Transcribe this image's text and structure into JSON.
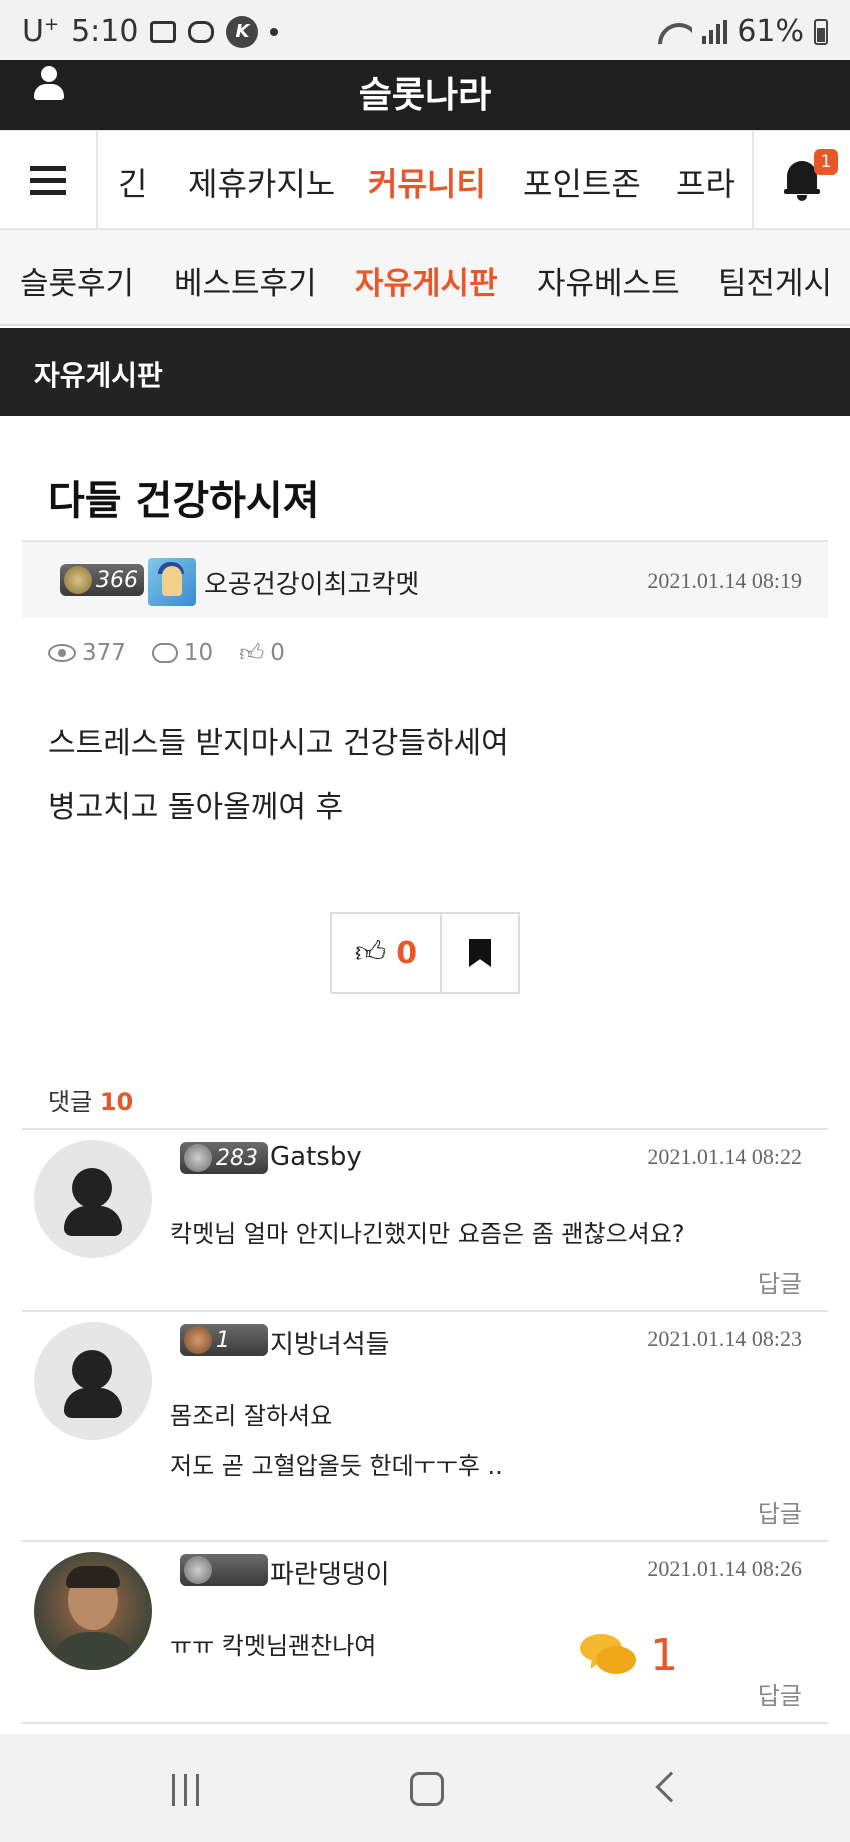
{
  "status_bar": {
    "carrier": "U",
    "carrier_sup": "+",
    "time": "5:10",
    "battery": "61%"
  },
  "header": {
    "site_title": "슬롯나라"
  },
  "main_nav": {
    "items": [
      "긴",
      "제휴카지노",
      "커뮤니티",
      "포인트존",
      "프라"
    ],
    "active": "커뮤니티",
    "notification_count": "1"
  },
  "sub_nav": {
    "items": [
      "슬롯후기",
      "베스트후기",
      "자유게시판",
      "자유베스트",
      "팀전게시"
    ],
    "active": "자유게시판"
  },
  "board": {
    "label": "자유게시판"
  },
  "post": {
    "title": "다들 건강하시져",
    "author": {
      "level": "366",
      "name": "오공건강이최고칵멧"
    },
    "date": "2021.01.14 08:19",
    "views": "377",
    "comments": "10",
    "likes": "0",
    "body": [
      "스트레스들 받지마시고 건강들하세여",
      "병고치고 돌아올께여 후"
    ],
    "like_button_count": "0"
  },
  "comments_section": {
    "label": "댓글",
    "count": "10",
    "items": [
      {
        "level": "283",
        "name": "Gatsby",
        "date": "2021.01.14 08:22",
        "lines": [
          "칵멧님 얼마 안지나긴했지만 요즘은 좀 괜찮으셔요?"
        ],
        "reply": "답글"
      },
      {
        "level": "1",
        "name": "지방녀석들",
        "date": "2021.01.14 08:23",
        "lines": [
          "몸조리 잘하셔요",
          "저도 곧 고혈압올듯 한데ㅜㅜ후 .."
        ],
        "reply": "답글"
      },
      {
        "level": "",
        "name": "파란댕댕이",
        "date": "2021.01.14 08:26",
        "lines": [
          "ㅠㅠ 칵멧님괜찬나여"
        ],
        "reply": "답글"
      }
    ]
  },
  "floating_chat": {
    "count": "1"
  },
  "colors": {
    "accent": "#e8572a",
    "header_bg": "#1f1f1f",
    "chat_icon": "#f5b82e"
  }
}
